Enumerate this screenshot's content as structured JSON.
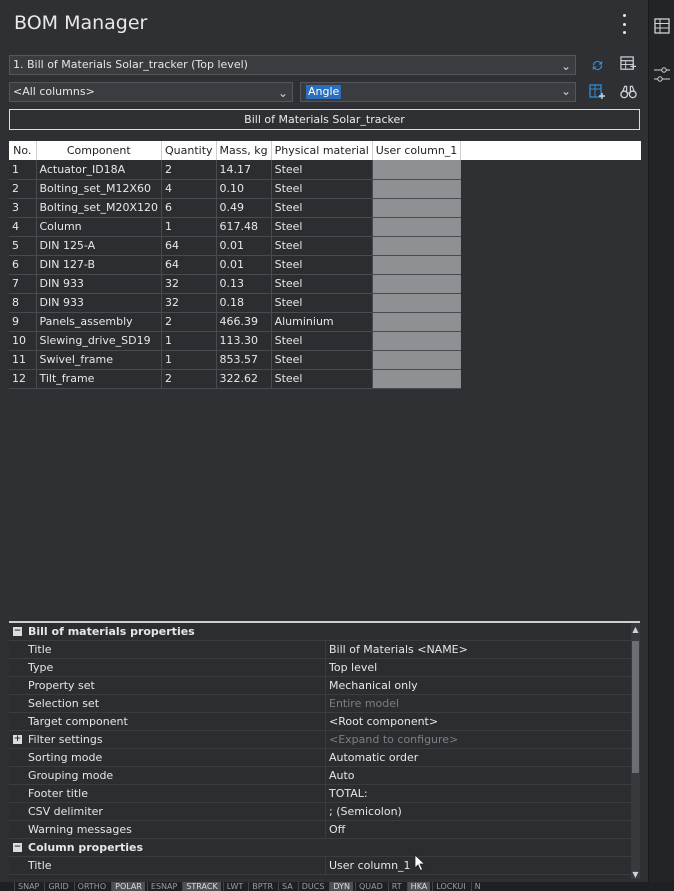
{
  "app": {
    "title": "BOM Manager"
  },
  "toolbar": {
    "bom_select_value": "1. Bill of Materials Solar_tracker (Top level)",
    "columns_select_value": "<All columns>",
    "column_value_text": "Angle"
  },
  "bom": {
    "title": "Bill of Materials Solar_tracker",
    "headers": [
      "No.",
      "Component",
      "Quantity",
      "Mass, kg",
      "Physical material",
      "User column_1"
    ],
    "rows": [
      {
        "no": "1",
        "component": "Actuator_ID18A",
        "quantity": "2",
        "mass": "14.17",
        "material": "Steel"
      },
      {
        "no": "2",
        "component": "Bolting_set_M12X60",
        "quantity": "4",
        "mass": "0.10",
        "material": "Steel"
      },
      {
        "no": "3",
        "component": "Bolting_set_M20X120",
        "quantity": "6",
        "mass": "0.49",
        "material": "Steel"
      },
      {
        "no": "4",
        "component": "Column",
        "quantity": "1",
        "mass": "617.48",
        "material": "Steel"
      },
      {
        "no": "5",
        "component": "DIN 125-A",
        "quantity": "64",
        "mass": "0.01",
        "material": "Steel"
      },
      {
        "no": "6",
        "component": "DIN 127-B",
        "quantity": "64",
        "mass": "0.01",
        "material": "Steel"
      },
      {
        "no": "7",
        "component": "DIN 933",
        "quantity": "32",
        "mass": "0.13",
        "material": "Steel"
      },
      {
        "no": "8",
        "component": "DIN 933",
        "quantity": "32",
        "mass": "0.18",
        "material": "Steel"
      },
      {
        "no": "9",
        "component": "Panels_assembly",
        "quantity": "2",
        "mass": "466.39",
        "material": "Aluminium"
      },
      {
        "no": "10",
        "component": "Slewing_drive_SD19",
        "quantity": "1",
        "mass": "113.30",
        "material": "Steel"
      },
      {
        "no": "11",
        "component": "Swivel_frame",
        "quantity": "1",
        "mass": "853.57",
        "material": "Steel"
      },
      {
        "no": "12",
        "component": "Tilt_frame",
        "quantity": "2",
        "mass": "322.62",
        "material": "Steel"
      }
    ]
  },
  "properties": {
    "bom_section_label": "Bill of materials properties",
    "bom_items": [
      {
        "key": "Title",
        "value": "Bill of Materials <NAME>"
      },
      {
        "key": "Type",
        "value": "Top level"
      },
      {
        "key": "Property set",
        "value": "Mechanical only"
      },
      {
        "key": "Selection set",
        "value": "Entire model"
      },
      {
        "key": "Target component",
        "value": "<Root component>"
      },
      {
        "key": "Filter settings",
        "value": "<Expand to configure>"
      },
      {
        "key": "Sorting mode",
        "value": "Automatic order"
      },
      {
        "key": "Grouping mode",
        "value": "Auto"
      },
      {
        "key": "Footer title",
        "value": "TOTAL:"
      },
      {
        "key": "CSV delimiter",
        "value": "; (Semicolon)"
      },
      {
        "key": "Warning messages",
        "value": "Off"
      }
    ],
    "column_section_label": "Column properties",
    "column_items": [
      {
        "key": "Title",
        "value": "User column_1"
      }
    ]
  },
  "statusbar": {
    "items": [
      "SNAP",
      "GRID",
      "ORTHO",
      "POLAR",
      "ESNAP",
      "STRACK",
      "LWT",
      "BPTR",
      "SA",
      "DUCS",
      "DYN",
      "QUAD",
      "RT",
      "HKA",
      "LOCKUI",
      "N"
    ]
  }
}
